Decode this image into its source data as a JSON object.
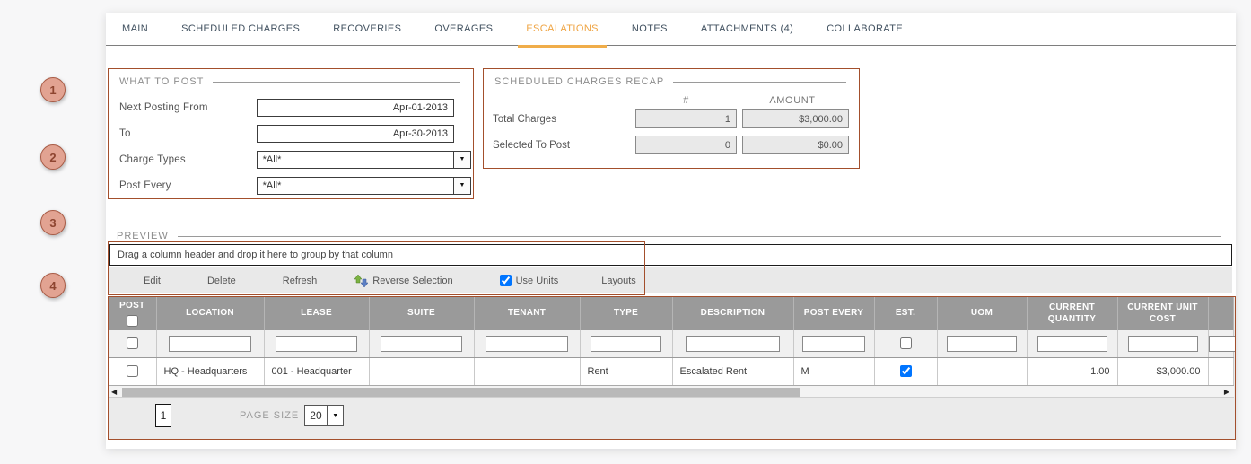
{
  "tabs": [
    {
      "label": "MAIN",
      "active": false
    },
    {
      "label": "SCHEDULED CHARGES",
      "active": false
    },
    {
      "label": "RECOVERIES",
      "active": false
    },
    {
      "label": "OVERAGES",
      "active": false
    },
    {
      "label": "ESCALATIONS",
      "active": true
    },
    {
      "label": "NOTES",
      "active": false
    },
    {
      "label": "ATTACHMENTS (4)",
      "active": false
    },
    {
      "label": "COLLABORATE",
      "active": false
    }
  ],
  "callouts": {
    "c1": "1",
    "c2": "2",
    "c3": "3",
    "c4": "4"
  },
  "what_to_post": {
    "title": "WHAT TO POST",
    "fields": [
      {
        "label": "Next Posting From",
        "value": "Apr-01-2013"
      },
      {
        "label": "To",
        "value": "Apr-30-2013"
      },
      {
        "label": "Charge Types",
        "value": "*All*"
      },
      {
        "label": "Post Every",
        "value": "*All*"
      }
    ]
  },
  "recap": {
    "title": "SCHEDULED CHARGES RECAP",
    "count_header": "#",
    "amount_header": "AMOUNT",
    "rows": [
      {
        "label": "Total Charges",
        "count": "1",
        "amount": "$3,000.00"
      },
      {
        "label": "Selected To Post",
        "count": "0",
        "amount": "$0.00"
      }
    ]
  },
  "preview": {
    "title": "PREVIEW",
    "group_hint": "Drag a column header and drop it here to group by that column",
    "toolbar": {
      "edit": "Edit",
      "delete": "Delete",
      "refresh": "Refresh",
      "reverse_selection": "Reverse Selection",
      "use_units": "Use Units",
      "use_units_checked": true,
      "layouts": "Layouts"
    },
    "columns": [
      "POST",
      "LOCATION",
      "LEASE",
      "SUITE",
      "TENANT",
      "TYPE",
      "DESCRIPTION",
      "POST EVERY",
      "EST.",
      "UOM",
      "CURRENT QUANTITY",
      "CURRENT UNIT COST",
      ""
    ],
    "row": {
      "post_checked": false,
      "location": "HQ - Headquarters",
      "lease": "001 - Headquarter",
      "suite": "",
      "tenant": "",
      "type": "Rent",
      "description": "Escalated Rent",
      "post_every": "M",
      "est_checked": true,
      "uom": "",
      "current_quantity": "1.00",
      "current_unit_cost": "$3,000.00"
    },
    "pager": {
      "page": "1",
      "page_size_label": "PAGE SIZE",
      "page_size": "20"
    }
  },
  "colors": {
    "accent_orange": "#efa443",
    "annotation_brown": "#a34f2c",
    "callout_fill": "#e2a392",
    "grid_header_gray": "#9a9a9a"
  }
}
